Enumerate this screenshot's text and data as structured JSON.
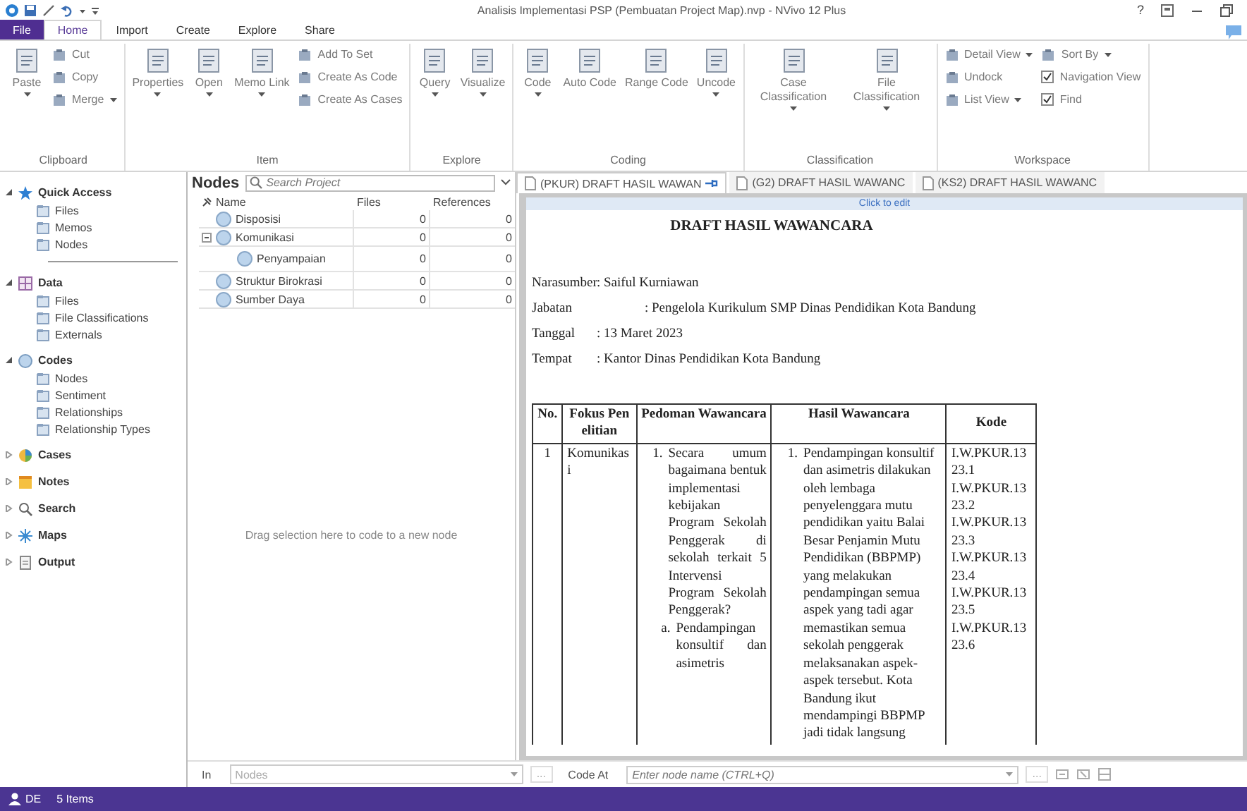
{
  "window": {
    "title": "Analisis Implementasi PSP (Pembuatan Project Map).nvp - NVivo 12 Plus",
    "help": "?"
  },
  "ribbon_tabs": [
    {
      "label": "File",
      "kind": "file",
      "selected": false
    },
    {
      "label": "Home",
      "kind": "tab",
      "selected": true
    },
    {
      "label": "Import",
      "kind": "tab",
      "selected": false
    },
    {
      "label": "Create",
      "kind": "tab",
      "selected": false
    },
    {
      "label": "Explore",
      "kind": "tab",
      "selected": false
    },
    {
      "label": "Share",
      "kind": "tab",
      "selected": false
    }
  ],
  "ribbon_groups": [
    {
      "label": "Clipboard",
      "items": [
        {
          "kind": "large",
          "label": "Paste",
          "dropdown": true
        },
        {
          "kind": "small",
          "label": "Cut",
          "dropdown": false
        },
        {
          "kind": "small",
          "label": "Copy",
          "dropdown": false
        },
        {
          "kind": "small",
          "label": "Merge",
          "dropdown": true
        }
      ]
    },
    {
      "label": "Item",
      "items": [
        {
          "kind": "large",
          "label": "Properties",
          "dropdown": true
        },
        {
          "kind": "large",
          "label": "Open",
          "dropdown": true
        },
        {
          "kind": "large",
          "label": "Memo Link",
          "dropdown": true
        },
        {
          "kind": "small",
          "label": "Add To Set",
          "dropdown": false
        },
        {
          "kind": "small",
          "label": "Create As Code",
          "dropdown": false
        },
        {
          "kind": "small",
          "label": "Create As Cases",
          "dropdown": false
        }
      ]
    },
    {
      "label": "Explore",
      "items": [
        {
          "kind": "large",
          "label": "Query",
          "dropdown": true
        },
        {
          "kind": "large",
          "label": "Visualize",
          "dropdown": true
        }
      ]
    },
    {
      "label": "Coding",
      "items": [
        {
          "kind": "large",
          "label": "Code",
          "dropdown": true
        },
        {
          "kind": "large",
          "label": "Auto Code",
          "dropdown": false
        },
        {
          "kind": "large",
          "label": "Range Code",
          "dropdown": false
        },
        {
          "kind": "large",
          "label": "Uncode",
          "dropdown": true
        }
      ]
    },
    {
      "label": "Classification",
      "items": [
        {
          "kind": "large",
          "label": "Case Classification",
          "dropdown": true
        },
        {
          "kind": "large",
          "label": "File Classification",
          "dropdown": true
        }
      ]
    },
    {
      "label": "Workspace",
      "items": [
        {
          "kind": "small",
          "label": "Detail View",
          "dropdown": true
        },
        {
          "kind": "small",
          "label": "Undock",
          "dropdown": false
        },
        {
          "kind": "small",
          "label": "List View",
          "dropdown": true
        },
        {
          "kind": "small",
          "label": "Sort By",
          "dropdown": true
        },
        {
          "kind": "check",
          "label": "Navigation View",
          "checked": true
        },
        {
          "kind": "check",
          "label": "Find",
          "checked": true
        }
      ]
    }
  ],
  "navigation": [
    {
      "kind": "favorites",
      "label": "Quick Access",
      "expanded": true,
      "items": [
        "Files",
        "Memos",
        "Nodes"
      ]
    },
    {
      "kind": "data",
      "label": "Data",
      "expanded": true,
      "items": [
        "Files",
        "File Classifications",
        "Externals"
      ]
    },
    {
      "kind": "codes",
      "label": "Codes",
      "expanded": true,
      "items": [
        "Nodes",
        "Sentiment",
        "Relationships",
        "Relationship Types"
      ]
    },
    {
      "kind": "cases",
      "label": "Cases",
      "expanded": false
    },
    {
      "kind": "notes",
      "label": "Notes",
      "expanded": false
    },
    {
      "kind": "search",
      "label": "Search",
      "expanded": false
    },
    {
      "kind": "maps",
      "label": "Maps",
      "expanded": false
    },
    {
      "kind": "output",
      "label": "Output",
      "expanded": false
    }
  ],
  "list_view": {
    "title": "Nodes",
    "search": {
      "placeholder": "Search Project"
    },
    "columns": [
      "Name",
      "Files",
      "References"
    ],
    "rows": [
      {
        "name": "Disposisi",
        "files": "0",
        "references": "0"
      },
      {
        "name": "Komunikasi",
        "files": "0",
        "references": "0",
        "expanded": true,
        "children": [
          {
            "name": "Penyampaian",
            "files": "0",
            "references": "0"
          }
        ]
      },
      {
        "name": "Struktur Birokrasi",
        "files": "0",
        "references": "0"
      },
      {
        "name": "Sumber Daya",
        "files": "0",
        "references": "0"
      }
    ],
    "drop_hint": "Drag selection here to code to a new node"
  },
  "document_tabs": [
    {
      "label": "(PKUR) DRAFT HASIL WAWAN",
      "selected": true
    },
    {
      "label": "(G2) DRAFT HASIL WAWANC",
      "selected": false
    },
    {
      "label": "(KS2) DRAFT HASIL WAWANC",
      "selected": false
    }
  ],
  "document": {
    "edit_bar": "Click to edit",
    "heading": "DRAFT HASIL WAWANCARA",
    "fields": [
      {
        "label": "Narasumber",
        "value": ": Saiful Kurniawan"
      },
      {
        "label": "Jabatan",
        "value": ": Pengelola Kurikulum SMP Dinas Pendidikan Kota Bandung"
      },
      {
        "label": "Tanggal",
        "value": ": 13 Maret 2023"
      },
      {
        "label": "Tempat",
        "value": ": Kantor Dinas Pendidikan Kota Bandung"
      }
    ],
    "table": {
      "columns": [
        "No.",
        "Fokus Penelitian",
        "Pedoman Wawancara",
        "Hasil Wawancara",
        "Kode"
      ],
      "rows": [
        {
          "no": "1",
          "focus": "Komunikasi",
          "guide": [
            {
              "marker": "1.",
              "text": "Secara umum bagaimana bentuk implementasi kebijakan Program Sekolah Penggerak di sekolah terkait 5 Intervensi Program Sekolah Penggerak?",
              "sub": [
                {
                  "marker": "a.",
                  "text": "Pendampingan konsultif dan asimetris"
                }
              ]
            }
          ],
          "result": [
            {
              "marker": "1.",
              "text": "Pendampingan konsultif dan asimetris dilakukan oleh lembaga penyelenggara mutu pendidikan yaitu Balai Besar Penjamin Mutu Pendidikan (BBPMP) yang melakukan pendampingan semua aspek yang tadi agar memastikan semua sekolah penggerak melaksanakan aspek-aspek tersebut. Kota Bandung ikut mendampingi BBPMP jadi tidak langsung"
            }
          ],
          "codes": [
            "I.W.PKUR.13",
            "23.1",
            "I.W.PKUR.13",
            "23.2",
            "I.W.PKUR.13",
            "23.3",
            "I.W.PKUR.13",
            "23.4",
            "I.W.PKUR.13",
            "23.5",
            "I.W.PKUR.13",
            "23.6"
          ]
        }
      ]
    }
  },
  "code_bar": {
    "in_label": "In",
    "in_value": "Nodes",
    "browse": "...",
    "code_at_label": "Code At",
    "code_at": {
      "placeholder": "Enter node name (CTRL+Q)"
    },
    "browse2": "..."
  },
  "status_bar": {
    "user": "DE",
    "items": "5 Items"
  }
}
